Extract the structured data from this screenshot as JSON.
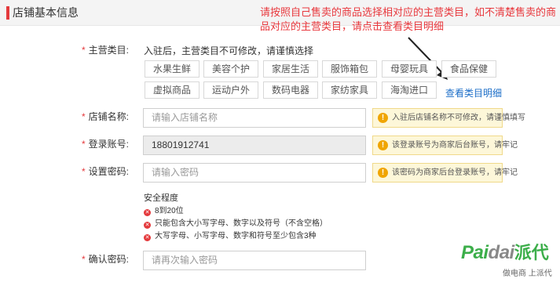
{
  "header": {
    "title": "店铺基本信息"
  },
  "annotation": {
    "text": "请按照自己售卖的商品选择相对应的主营类目，如不清楚售卖的商品对应的主营类目，请点击查看类目明细"
  },
  "category": {
    "label": "主营类目:",
    "hint": "入驻后，主营类目不可修改，请谨慎选择",
    "row1": [
      "水果生鲜",
      "美容个护",
      "家居生活",
      "服饰箱包",
      "母婴玩具",
      "食品保健"
    ],
    "row2": [
      "虚拟商品",
      "运动户外",
      "数码电器",
      "家纺家具",
      "海淘进口"
    ],
    "detail_link": "查看类目明细"
  },
  "shop_name": {
    "label": "店铺名称:",
    "placeholder": "请输入店铺名称",
    "tip": "入驻后店铺名称不可修改，请谨慎填写"
  },
  "account": {
    "label": "登录账号:",
    "value": "18801912741",
    "tip": "该登录账号为商家后台账号，请牢记"
  },
  "password": {
    "label": "设置密码:",
    "placeholder": "请输入密码",
    "tip": "该密码为商家后台登录账号，请牢记"
  },
  "strength": {
    "title": "安全程度",
    "rules": [
      "8到20位",
      "只能包含大小写字母、数字以及符号（不含空格）",
      "大写字母、小写字母、数字和符号至少包含3种"
    ]
  },
  "confirm": {
    "label": "确认密码:",
    "placeholder": "请再次输入密码"
  },
  "watermark": {
    "brand_pai": "Pai",
    "brand_dai": "dai",
    "brand_cn": "派代",
    "sub": "做电商 上派代"
  },
  "colors": {
    "accent": "#e4393c",
    "link": "#1e6fc8",
    "tip_bg": "#fdf7d9",
    "watermark": "#3cae4a"
  }
}
